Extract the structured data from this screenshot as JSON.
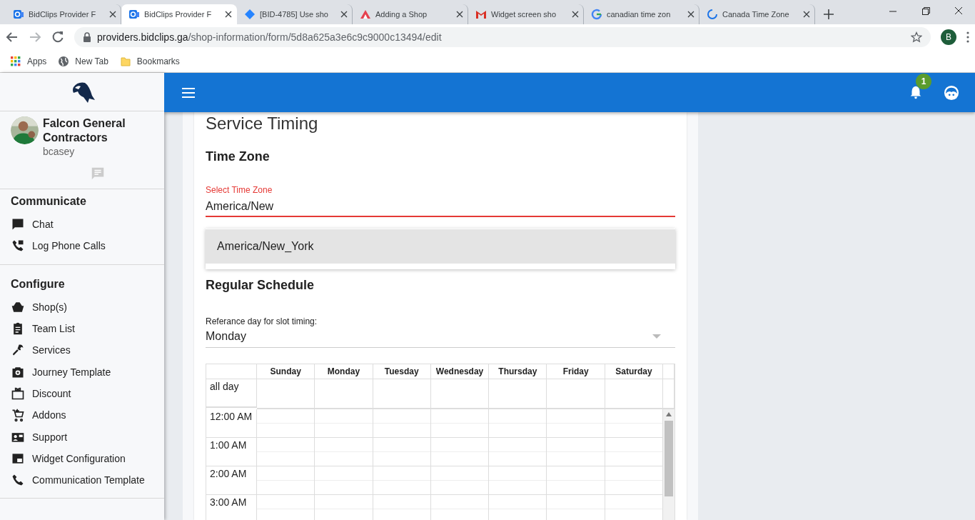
{
  "browser": {
    "tabs": [
      {
        "kind": "app",
        "title": "BidClips Provider F",
        "selected": false
      },
      {
        "kind": "app",
        "title": "BidClips Provider F",
        "selected": true
      },
      {
        "kind": "diamond",
        "title": "[BID-4785] Use sho",
        "selected": false
      },
      {
        "kind": "triangle",
        "title": "Adding a Shop",
        "selected": false
      },
      {
        "kind": "mail",
        "title": "Widget screen sho",
        "selected": false
      },
      {
        "kind": "g",
        "title": "canadian time zon",
        "selected": false
      },
      {
        "kind": "spinner",
        "title": "Canada Time Zone",
        "selected": false
      }
    ],
    "url": {
      "host": "providers.bidclips.ga",
      "path": "/shop-information/form/5d8a625a3e6c9c9000c13494/edit"
    },
    "profile": "B",
    "bookmarks": [
      {
        "kind": "apps",
        "label": "Apps"
      },
      {
        "kind": "globe",
        "label": "New Tab"
      },
      {
        "kind": "folder",
        "label": "Bookmarks"
      }
    ]
  },
  "sidebar": {
    "user": {
      "name": "Falcon General Contractors",
      "username": "bcasey"
    },
    "sections": [
      {
        "title": "Communicate",
        "items": [
          {
            "kind": "chat",
            "label": "Chat"
          },
          {
            "kind": "phone",
            "label": "Log Phone Calls"
          }
        ]
      },
      {
        "title": "Configure",
        "items": [
          {
            "kind": "basket",
            "label": "Shop(s)"
          },
          {
            "kind": "clipboard",
            "label": "Team List"
          },
          {
            "kind": "wrench",
            "label": "Services"
          },
          {
            "kind": "camera",
            "label": "Journey Template"
          },
          {
            "kind": "gift",
            "label": "Discount"
          },
          {
            "kind": "cart",
            "label": "Addons"
          },
          {
            "kind": "card",
            "label": "Support"
          },
          {
            "kind": "widget",
            "label": "Widget Configuration"
          },
          {
            "kind": "phone-sync",
            "label": "Communication Template"
          }
        ]
      }
    ]
  },
  "header": {
    "notifications": "1"
  },
  "card": {
    "title": "Service Timing",
    "time_zone": {
      "heading": "Time Zone",
      "field": {
        "label": "Select Time Zone",
        "value": "America/New"
      },
      "options": [
        {
          "label": "America/New_York",
          "selected": true
        }
      ]
    },
    "schedule": {
      "heading": "Regular Schedule",
      "reference": {
        "label": "Referance day for slot timing:",
        "value": "Monday"
      },
      "calendar": {
        "days": [
          "Sunday",
          "Monday",
          "Tuesday",
          "Wednesday",
          "Thursday",
          "Friday",
          "Saturday"
        ],
        "all_day": "all day",
        "times": [
          "12:00 AM",
          "1:00 AM",
          "2:00 AM",
          "3:00 AM"
        ]
      }
    }
  }
}
